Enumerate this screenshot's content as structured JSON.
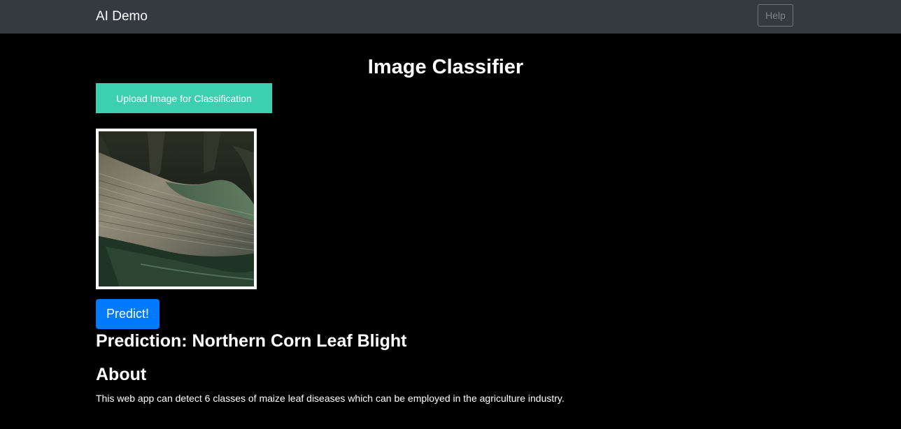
{
  "navbar": {
    "brand": "AI Demo",
    "help_label": "Help"
  },
  "main": {
    "title": "Image Classifier",
    "upload_label": "Upload Image for Classification",
    "predict_label": "Predict!",
    "prediction_text": "Prediction: Northern Corn Leaf Blight",
    "about_heading": "About",
    "about_text": "This web app can detect 6 classes of maize leaf diseases which can be employed in the agriculture industry."
  },
  "colors": {
    "background": "#000000",
    "navbar": "#343a40",
    "upload_button": "#3ccfb0",
    "predict_button": "#007bff"
  }
}
